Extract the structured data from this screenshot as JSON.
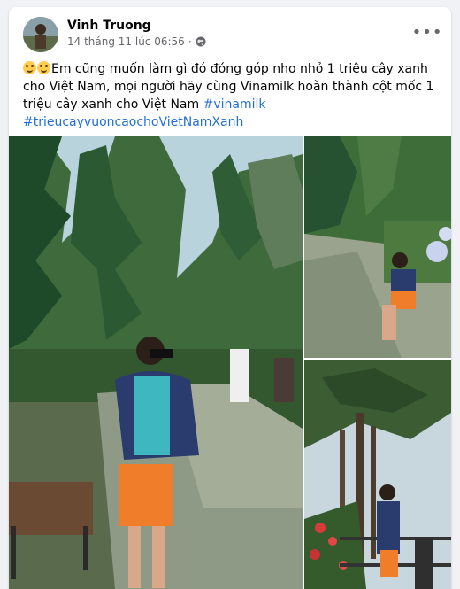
{
  "post": {
    "author": "Vinh Truong",
    "timestamp": "14 tháng 11 lúc 06:56",
    "separator": "·",
    "privacy_icon": "globe-icon",
    "more_icon": "more-options-icon",
    "more_label": "•••",
    "emojis": [
      "grinning-face-emoji",
      "grinning-face-emoji"
    ],
    "body_text": "Em cũng muốn làm gì đó đóng góp nho nhỏ 1 triệu cây xanh cho Việt Nam, mọi người hãy cùng Vinamilk hoàn thành cột mốc 1 triệu cây xanh cho Việt Nam ",
    "hashtag_1": "#vinamilk",
    "hashtag_2": "#trieucayvuoncaochoVietNamXanh"
  },
  "colors": {
    "link": "#216fdb",
    "text": "#050505",
    "secondary_text": "#65676b",
    "background": "#f0f2f5"
  }
}
